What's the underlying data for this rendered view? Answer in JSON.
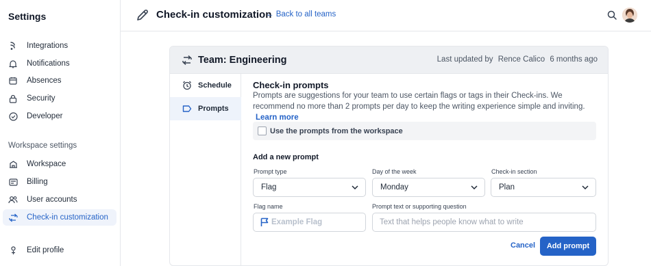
{
  "sidebar": {
    "title": "Settings",
    "items": [
      {
        "label": "Integrations",
        "icon": "integrations-icon"
      },
      {
        "label": "Notifications",
        "icon": "bell-icon"
      },
      {
        "label": "Absences",
        "icon": "calendar-icon"
      },
      {
        "label": "Security",
        "icon": "lock-icon"
      },
      {
        "label": "Developer",
        "icon": "check-circle-icon"
      }
    ],
    "workspace_section": "Workspace settings",
    "workspace_items": [
      {
        "label": "Workspace",
        "icon": "building-icon"
      },
      {
        "label": "Billing",
        "icon": "billing-icon"
      },
      {
        "label": "User accounts",
        "icon": "users-icon"
      },
      {
        "label": "Check-in customization",
        "icon": "checkin-icon",
        "active": true
      }
    ],
    "edit_profile": "Edit profile"
  },
  "header": {
    "title": "Check-in customization",
    "back_link": "← Back to all teams"
  },
  "card": {
    "team_title": "Team: Engineering",
    "updated_prefix": "Last updated by",
    "updated_user": "Rence Calico",
    "updated_time": "6 months ago",
    "tabs": [
      {
        "label": "Schedule",
        "icon": "alarm-clock-icon"
      },
      {
        "label": "Prompts",
        "icon": "tag-icon",
        "active": true
      }
    ],
    "prompts": {
      "title": "Check-in prompts",
      "description": "Prompts are suggestions for your team to use certain flags or tags in their Check-ins. We recommend no more than 2 prompts per day to keep the writing experience simple and inviting.",
      "learn_more": "Learn more",
      "workspace_checkbox": "Use the prompts from the workspace"
    },
    "new_prompt": {
      "title": "Add a new prompt",
      "prompt_type_label": "Prompt type",
      "prompt_type_value": "Flag",
      "day_label": "Day of the week",
      "day_value": "Monday",
      "section_label": "Check-in section",
      "section_value": "Plan",
      "flag_name_label": "Flag name",
      "flag_name_placeholder": "Example Flag",
      "prompt_text_label": "Prompt text or supporting question",
      "prompt_text_placeholder": "Text that helps people know what to write",
      "cancel": "Cancel",
      "submit": "Add prompt"
    }
  },
  "colors": {
    "accent": "#2563c7",
    "flag": "#2563c7"
  }
}
